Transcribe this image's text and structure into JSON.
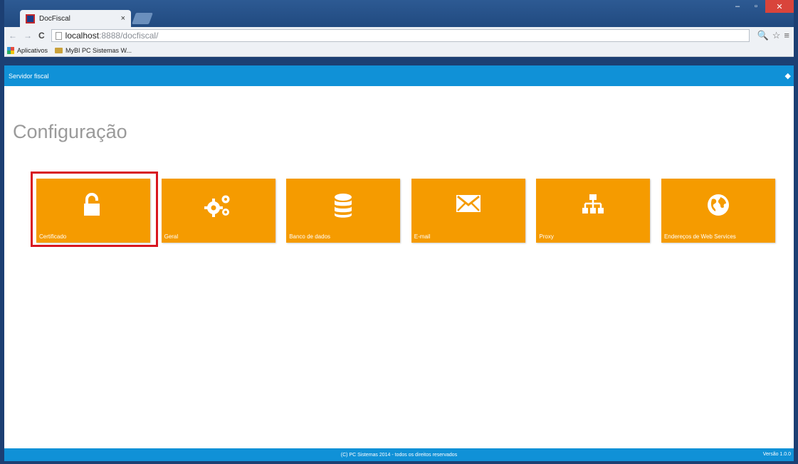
{
  "browser": {
    "tab_title": "DocFiscal",
    "tab_close": "×",
    "window_buttons": {
      "minimize": "–",
      "maximize": "▫",
      "close": "✕"
    },
    "nav": {
      "back": "←",
      "forward": "→",
      "reload": "C"
    },
    "url_host": "localhost",
    "url_rest": ":8888/docfiscal/",
    "toolbar_icons": {
      "zoom": "🔍",
      "star": "☆",
      "menu": "≡"
    },
    "bookmarks": [
      {
        "label": "Aplicativos"
      },
      {
        "label": "MyBI PC Sistemas W..."
      }
    ]
  },
  "app": {
    "bar_title": "Servidor fiscal",
    "bar_right_icon": "◆",
    "page_title": "Configuração",
    "tiles": [
      {
        "label": "Certificado",
        "icon": "unlock-icon",
        "selected": true
      },
      {
        "label": "Geral",
        "icon": "gears-icon",
        "selected": false
      },
      {
        "label": "Banco de dados",
        "icon": "database-icon",
        "selected": false
      },
      {
        "label": "E-mail",
        "icon": "envelope-icon",
        "selected": false
      },
      {
        "label": "Proxy",
        "icon": "sitemap-icon",
        "selected": false
      },
      {
        "label": "Endereços de Web Services",
        "icon": "globe-icon",
        "selected": false
      }
    ],
    "tile_color": "#f59b00",
    "accent_color": "#1091d7",
    "selection_color": "#d8161f",
    "footer": "(C) PC Sistemas 2014 - todos os direitos reservados",
    "version": "Versão 1.0.0"
  }
}
